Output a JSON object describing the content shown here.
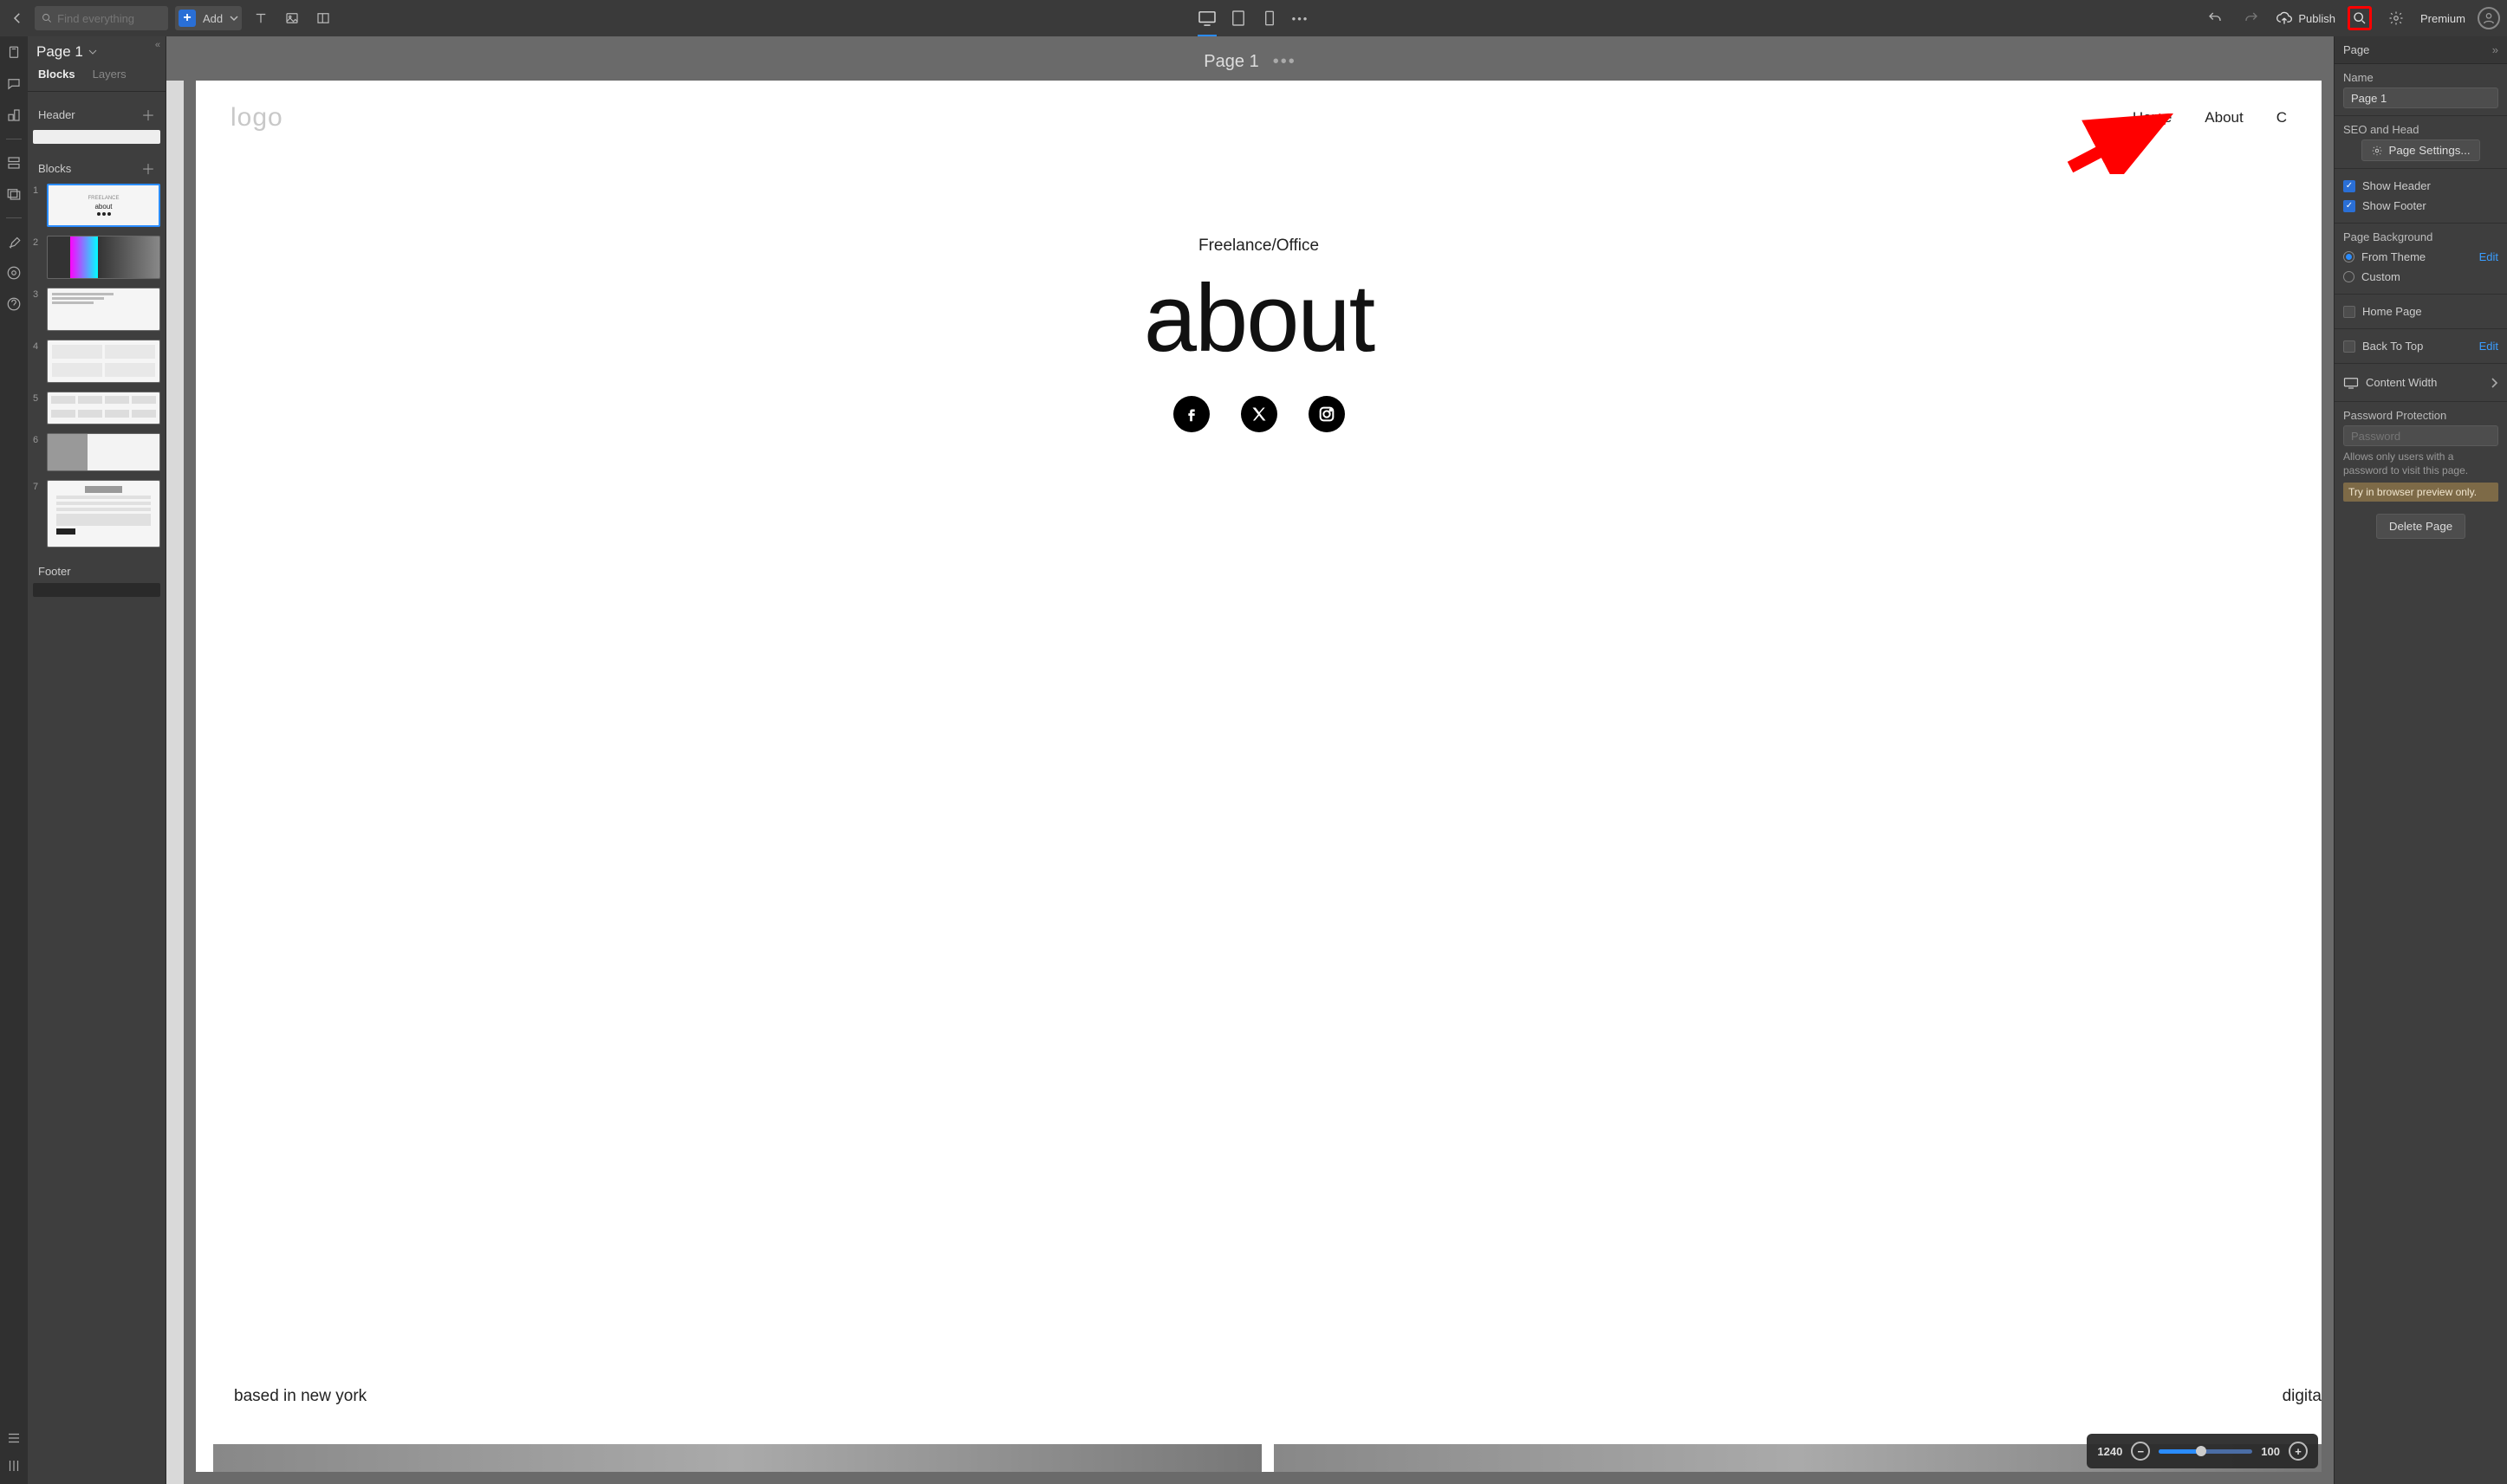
{
  "topbar": {
    "search_placeholder": "Find everything",
    "add_label": "Add",
    "publish_label": "Publish",
    "premium_label": "Premium"
  },
  "sidebar": {
    "page_selector": "Page 1",
    "tabs": {
      "blocks": "Blocks",
      "layers": "Layers"
    },
    "sections": {
      "header": "Header",
      "blocks": "Blocks",
      "footer": "Footer"
    },
    "block_numbers": [
      "1",
      "2",
      "3",
      "4",
      "5",
      "6",
      "7"
    ],
    "thumb_about": "about"
  },
  "canvas": {
    "title": "Page 1",
    "logo": "logo",
    "nav": [
      "Home",
      "About",
      "C"
    ],
    "hero_sub": "Freelance/Office",
    "hero_big": "about",
    "bottom_left": "based in new york",
    "bottom_right": "digita"
  },
  "zoom": {
    "width": "1240",
    "percent": "100"
  },
  "panel": {
    "head": "Page",
    "name_label": "Name",
    "name_value": "Page 1",
    "seo_label": "SEO and Head",
    "page_settings": "Page Settings...",
    "show_header": "Show Header",
    "show_footer": "Show Footer",
    "bg_label": "Page Background",
    "from_theme": "From Theme",
    "custom": "Custom",
    "edit": "Edit",
    "home_page": "Home Page",
    "back_to_top": "Back To Top",
    "content_width": "Content Width",
    "pw_label": "Password Protection",
    "pw_placeholder": "Password",
    "pw_note": "Allows only users with a password to visit this page.",
    "pw_warn": "Try in browser preview only.",
    "delete": "Delete Page"
  }
}
